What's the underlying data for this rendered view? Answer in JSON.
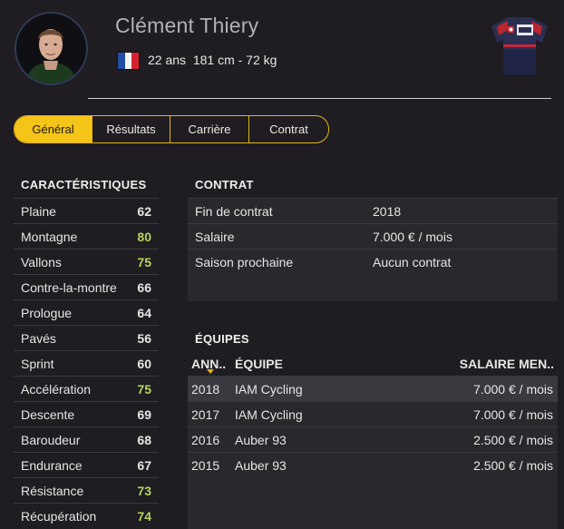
{
  "rider": {
    "name": "Clément Thiery",
    "age": "22 ans",
    "height_weight": "181 cm - 72 kg",
    "flag_colors": [
      "#1f4ea3",
      "#f4f4f4",
      "#d5222e"
    ]
  },
  "tabs": [
    {
      "label": "Général",
      "active": true
    },
    {
      "label": "Résultats",
      "active": false
    },
    {
      "label": "Carrière",
      "active": false
    },
    {
      "label": "Contrat",
      "active": false
    }
  ],
  "characteristics": {
    "title": "CARACTÉRISTIQUES",
    "rows": [
      {
        "label": "Plaine",
        "value": "62",
        "highlight": false
      },
      {
        "label": "Montagne",
        "value": "80",
        "highlight": true
      },
      {
        "label": "Vallons",
        "value": "75",
        "highlight": true
      },
      {
        "label": "Contre-la-montre",
        "value": "66",
        "highlight": false
      },
      {
        "label": "Prologue",
        "value": "64",
        "highlight": false
      },
      {
        "label": "Pavés",
        "value": "56",
        "highlight": false
      },
      {
        "label": "Sprint",
        "value": "60",
        "highlight": false
      },
      {
        "label": "Accélération",
        "value": "75",
        "highlight": true
      },
      {
        "label": "Descente",
        "value": "69",
        "highlight": false
      },
      {
        "label": "Baroudeur",
        "value": "68",
        "highlight": false
      },
      {
        "label": "Endurance",
        "value": "67",
        "highlight": false
      },
      {
        "label": "Résistance",
        "value": "73",
        "highlight": true
      },
      {
        "label": "Récupération",
        "value": "74",
        "highlight": true
      }
    ],
    "highlight_color": "#b5d45f"
  },
  "contract": {
    "title": "CONTRAT",
    "rows": [
      {
        "label": "Fin de contrat",
        "value": "2018"
      },
      {
        "label": "Salaire",
        "value": "7.000 € / mois"
      },
      {
        "label": "Saison prochaine",
        "value": "Aucun contrat"
      }
    ]
  },
  "teams": {
    "title": "ÉQUIPES",
    "columns": {
      "year": "ANN..",
      "team": "ÉQUIPE",
      "salary": "SALAIRE MEN.."
    },
    "rows": [
      {
        "year": "2018",
        "team": "IAM Cycling",
        "salary": "7.000 € / mois",
        "selected": true
      },
      {
        "year": "2017",
        "team": "IAM Cycling",
        "salary": "7.000 € / mois",
        "selected": false
      },
      {
        "year": "2016",
        "team": "Auber 93",
        "salary": "2.500 € / mois",
        "selected": false
      },
      {
        "year": "2015",
        "team": "Auber 93",
        "salary": "2.500 € / mois",
        "selected": false
      }
    ]
  },
  "colors": {
    "accent": "#f5c418",
    "background": "#1f1c22"
  }
}
